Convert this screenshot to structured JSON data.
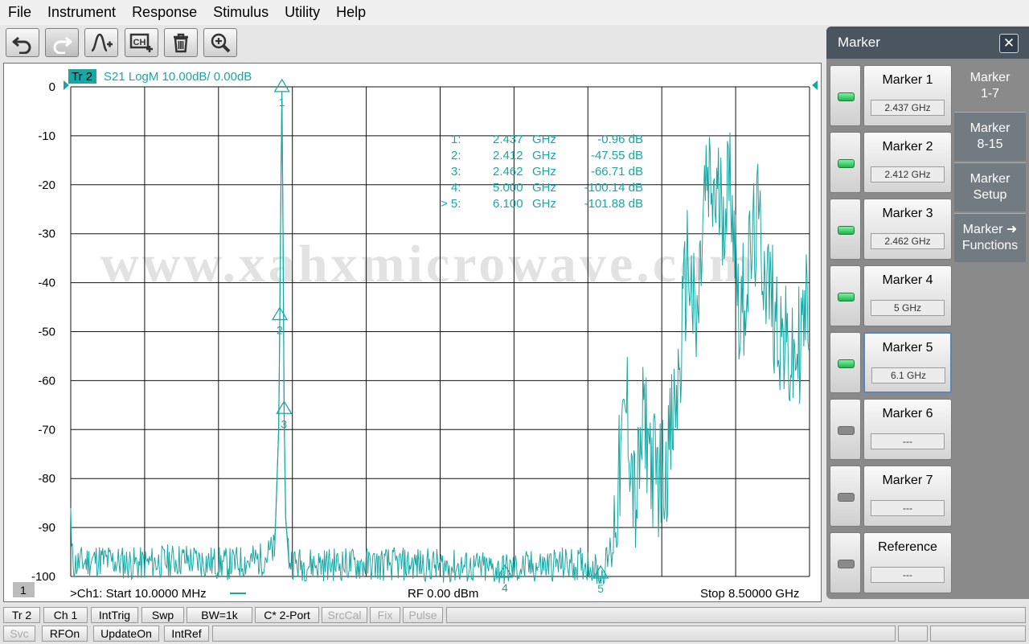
{
  "menu": [
    "File",
    "Instrument",
    "Response",
    "Stimulus",
    "Utility",
    "Help"
  ],
  "toolbar": {
    "buttons": [
      {
        "name": "undo-button",
        "icon": "undo-icon"
      },
      {
        "name": "redo-button",
        "icon": "redo-icon"
      },
      {
        "name": "add-marker-button",
        "icon": "marker-add-icon"
      },
      {
        "name": "add-channel-button",
        "icon": "channel-add-icon"
      },
      {
        "name": "delete-button",
        "icon": "trash-icon"
      },
      {
        "name": "zoom-button",
        "icon": "zoom-icon"
      }
    ]
  },
  "trace": {
    "badge": "Tr 2",
    "label": "S21 LogM 10.00dB/  0.00dB",
    "color": "#19a7a3",
    "channel_badge": "1",
    "start": ">Ch1:  Start   10.0000 MHz",
    "power": "RF     0.00 dBm",
    "stop": "Stop  8.50000 GHz"
  },
  "watermark": "www.xahxmicrowave.com",
  "marker_table": [
    {
      "id": "1:",
      "freq": "2.437",
      "unit": "GHz",
      "value": "-0.96 dB",
      "active": false
    },
    {
      "id": "2:",
      "freq": "2.412",
      "unit": "GHz",
      "value": "-47.55 dB",
      "active": false
    },
    {
      "id": "3:",
      "freq": "2.462",
      "unit": "GHz",
      "value": "-66.71 dB",
      "active": false
    },
    {
      "id": "4:",
      "freq": "5.000",
      "unit": "GHz",
      "value": "-100.14 dB",
      "active": false
    },
    {
      "id": "5:",
      "freq": "6.100",
      "unit": "GHz",
      "value": "-101.88 dB",
      "active": true
    }
  ],
  "chart_data": {
    "type": "line",
    "ylabel": "",
    "xlabel": "",
    "xlim_ghz": [
      0.01,
      8.5
    ],
    "ylim_db": [
      -100,
      0
    ],
    "grid": true,
    "yticks": [
      "0",
      "-10",
      "-20",
      "-30",
      "-40",
      "-50",
      "-60",
      "-70",
      "-80",
      "-90",
      "-100"
    ],
    "series": [
      {
        "x_ghz": [
          0.01,
          0.02,
          0.05,
          0.3,
          0.8,
          1.3,
          1.8,
          2.2,
          2.35,
          2.4,
          2.412,
          2.42,
          2.437,
          2.45,
          2.462,
          2.48,
          2.52,
          2.6,
          3.2,
          4.0,
          5.0,
          5.6,
          6.0,
          6.1,
          6.2,
          6.3,
          6.4,
          6.5,
          6.6,
          6.7,
          6.8,
          6.9,
          7.0,
          7.1,
          7.2,
          7.3,
          7.5,
          7.6,
          7.7,
          7.9,
          8.0,
          8.1,
          8.3,
          8.4,
          8.5
        ],
        "y_db": [
          -86,
          -97,
          -99,
          -98,
          -99,
          -98,
          -99,
          -98,
          -96,
          -70,
          -47.55,
          -30,
          -0.96,
          -30,
          -66.71,
          -88,
          -98,
          -99,
          -99,
          -99,
          -100.14,
          -99,
          -99,
          -101.88,
          -97,
          -82,
          -64,
          -87,
          -67,
          -78,
          -80,
          -73,
          -60,
          -34,
          -52,
          -21,
          -24,
          -19,
          -47,
          -28,
          -38,
          -46,
          -58,
          -51,
          -43
        ]
      }
    ],
    "markers": [
      {
        "label": "1",
        "x_ghz": 2.437,
        "y_db": -0.96
      },
      {
        "label": "2",
        "x_ghz": 2.412,
        "y_db": -47.55
      },
      {
        "label": "3",
        "x_ghz": 2.462,
        "y_db": -66.71
      },
      {
        "label": "4",
        "x_ghz": 5.0,
        "y_db": -100.14
      },
      {
        "label": "5",
        "x_ghz": 6.1,
        "y_db": -101.88
      }
    ]
  },
  "status_row1": [
    {
      "label": "Tr 2",
      "dim": false
    },
    {
      "label": "Ch 1",
      "dim": false
    },
    {
      "label": "IntTrig",
      "dim": false
    },
    {
      "label": "Swp",
      "dim": false
    },
    {
      "label": "BW=1k",
      "dim": false
    },
    {
      "label": "C* 2-Port",
      "dim": false
    },
    {
      "label": "SrcCal",
      "dim": true
    },
    {
      "label": "Fix",
      "dim": true
    },
    {
      "label": "Pulse",
      "dim": true
    }
  ],
  "status_row2": [
    {
      "label": "Svc",
      "dim": true
    },
    {
      "label": "RFOn",
      "dim": false
    },
    {
      "label": "UpdateOn",
      "dim": false
    },
    {
      "label": "IntRef",
      "dim": false
    }
  ],
  "marker_panel": {
    "title": "Marker",
    "close": "✕",
    "markers": [
      {
        "label": "Marker 1",
        "value": "2.437 GHz",
        "on": true
      },
      {
        "label": "Marker 2",
        "value": "2.412 GHz",
        "on": true
      },
      {
        "label": "Marker 3",
        "value": "2.462 GHz",
        "on": true
      },
      {
        "label": "Marker 4",
        "value": "5 GHz",
        "on": true
      },
      {
        "label": "Marker 5",
        "value": "6.1 GHz",
        "on": true,
        "active": true
      },
      {
        "label": "Marker 6",
        "value": "---",
        "on": false
      },
      {
        "label": "Marker 7",
        "value": "---",
        "on": false
      },
      {
        "label": "Reference",
        "value": "---",
        "on": false
      }
    ],
    "tabs": [
      {
        "line1": "Marker",
        "line2": "1-7",
        "selected": true
      },
      {
        "line1": "Marker",
        "line2": "8-15",
        "selected": false
      },
      {
        "line1": "Marker",
        "line2": "Setup",
        "selected": false
      },
      {
        "line1": "Marker ➜",
        "line2": "Functions",
        "selected": false
      }
    ]
  }
}
